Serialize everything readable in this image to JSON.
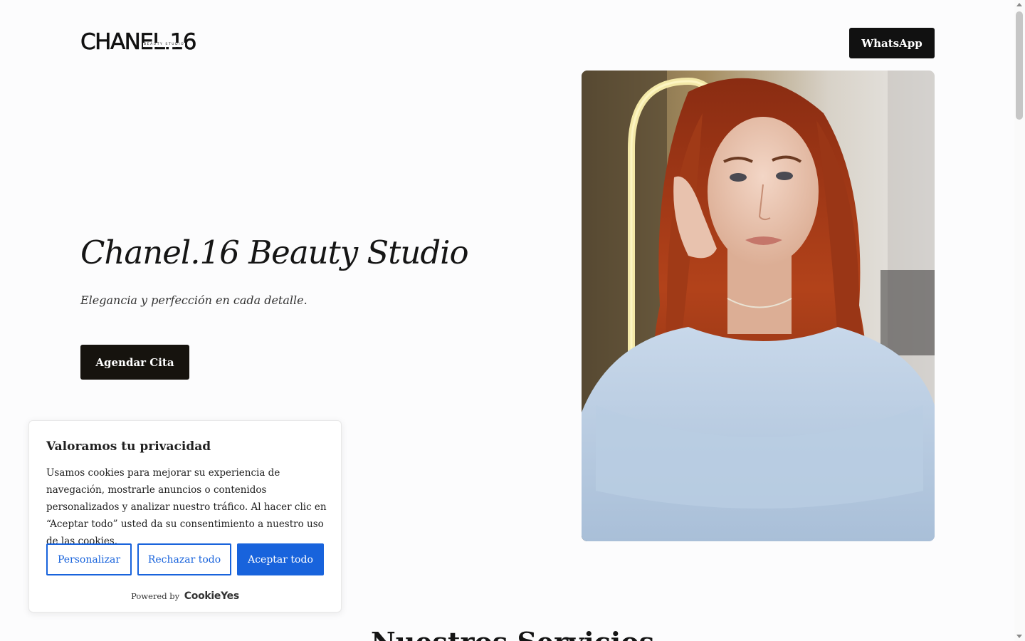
{
  "header": {
    "logo_text": "CHANEL.16",
    "logo_subtext": "BEAUTY STUDIO",
    "whatsapp_label": "WhatsApp"
  },
  "hero": {
    "title": "Chanel.16 Beauty Studio",
    "subtitle": "Elegancia y perfección en cada detalle.",
    "cta_label": "Agendar Cita",
    "image_icon": "portrait-photo"
  },
  "next_section": {
    "heading": "Nuestros Servicios"
  },
  "cookie_banner": {
    "title": "Valoramos tu privacidad",
    "text": "Usamos cookies para mejorar su experiencia de navegación, mostrarle anuncios o contenidos personalizados y analizar nuestro tráfico. Al hacer clic en “Aceptar todo” usted da su consentimiento a nuestro uso de las cookies.",
    "customize_label": "Personalizar",
    "reject_label": "Rechazar todo",
    "accept_label": "Aceptar todo",
    "powered_by": "Powered by",
    "powered_brand": "CookieYes"
  },
  "colors": {
    "primary_dark": "#111111",
    "cookie_accent": "#1863dc",
    "page_background": "#fcfcfd"
  }
}
